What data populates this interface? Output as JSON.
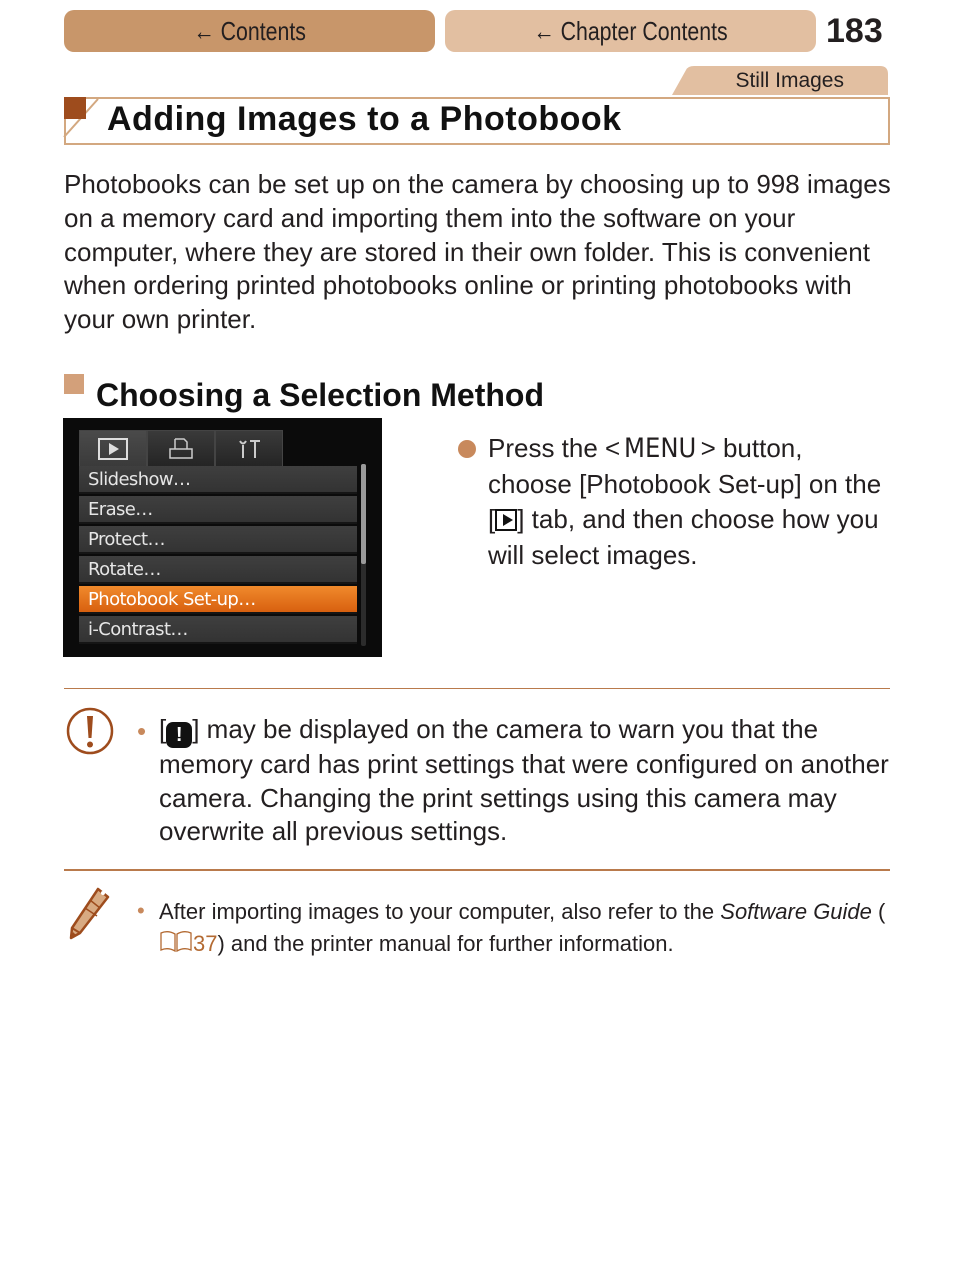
{
  "nav": {
    "contents_label": "← Contents",
    "chapter_contents_label": "← Chapter Contents",
    "page_number": "183"
  },
  "section_tab": "Still Images",
  "title": "Adding Images to a Photobook",
  "intro": "Photobooks can be set up on the camera by choosing up to 998 images on a memory card and importing them into the software on your computer, where they are stored in their own folder. This is convenient when ordering printed photobooks online or printing photobooks with your own printer.",
  "subsection_title": "Choosing a Selection Method",
  "camera_screen": {
    "tabs": [
      {
        "icon": "playback-icon",
        "active": true
      },
      {
        "icon": "print-icon",
        "active": false
      },
      {
        "icon": "settings-icon",
        "active": false
      }
    ],
    "menu_items": [
      {
        "label": "Slideshow…",
        "selected": false
      },
      {
        "label": "Erase…",
        "selected": false
      },
      {
        "label": "Protect…",
        "selected": false
      },
      {
        "label": "Rotate…",
        "selected": false
      },
      {
        "label": "Photobook Set-up…",
        "selected": true
      },
      {
        "label": "i-Contrast…",
        "selected": false
      }
    ],
    "colors": {
      "selected": "#e8731e"
    }
  },
  "step": {
    "part1": "Press the <",
    "menu_word": "MENU",
    "part2": "> button, choose [Photobook Set-up] on the [",
    "part3": "] tab, and then choose how you will select images."
  },
  "caution": {
    "bullet": "•",
    "part1": "[",
    "badge": "!",
    "part2": "] may be displayed on the camera to warn you that the memory card has print settings that were configured on another camera. Changing the print settings using this camera may overwrite all previous settings."
  },
  "note": {
    "bullet": "•",
    "part1": "After importing images to your computer, also refer to the ",
    "italic1": "Software Guide",
    "part2": " (",
    "ref_page": "37",
    "part3": ") and the printer manual for further information."
  },
  "colors": {
    "accent_dark": "#9e4c1d",
    "accent": "#c8966a",
    "accent_light": "#e2bfa1"
  }
}
